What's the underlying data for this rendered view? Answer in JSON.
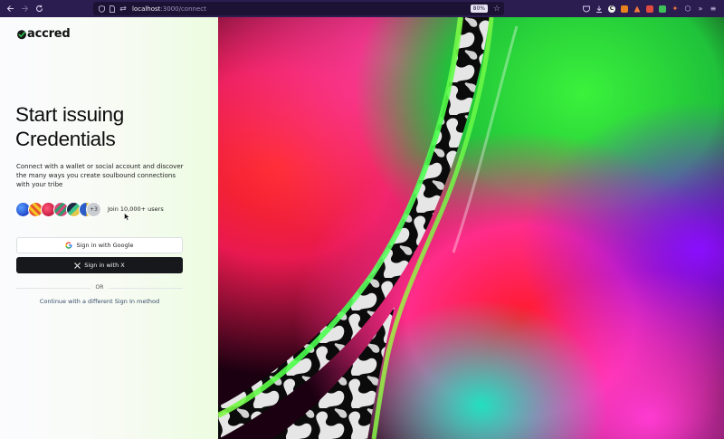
{
  "browser": {
    "url_host": "localhost",
    "url_path": ":3000/connect",
    "zoom": "80%",
    "extension_letter": "C"
  },
  "brand": {
    "name": "accred"
  },
  "hero": {
    "title_line1": "Start issuing",
    "title_line2": "Credentials",
    "subtitle": "Connect with a wallet or social account and discover the many ways you create soulbound connections with your tribe"
  },
  "social_proof": {
    "more_count": "+3",
    "text": "Join 10,000+ users"
  },
  "auth": {
    "google_label": "Sign in with Google",
    "x_label": "Sign in with X",
    "or_label": "OR",
    "alt_label": "Continue with a different Sign In method"
  },
  "colors": {
    "chrome_bg": "#2b1d4f",
    "brand_green": "#2fbf4f",
    "dark_button": "#16181b"
  }
}
